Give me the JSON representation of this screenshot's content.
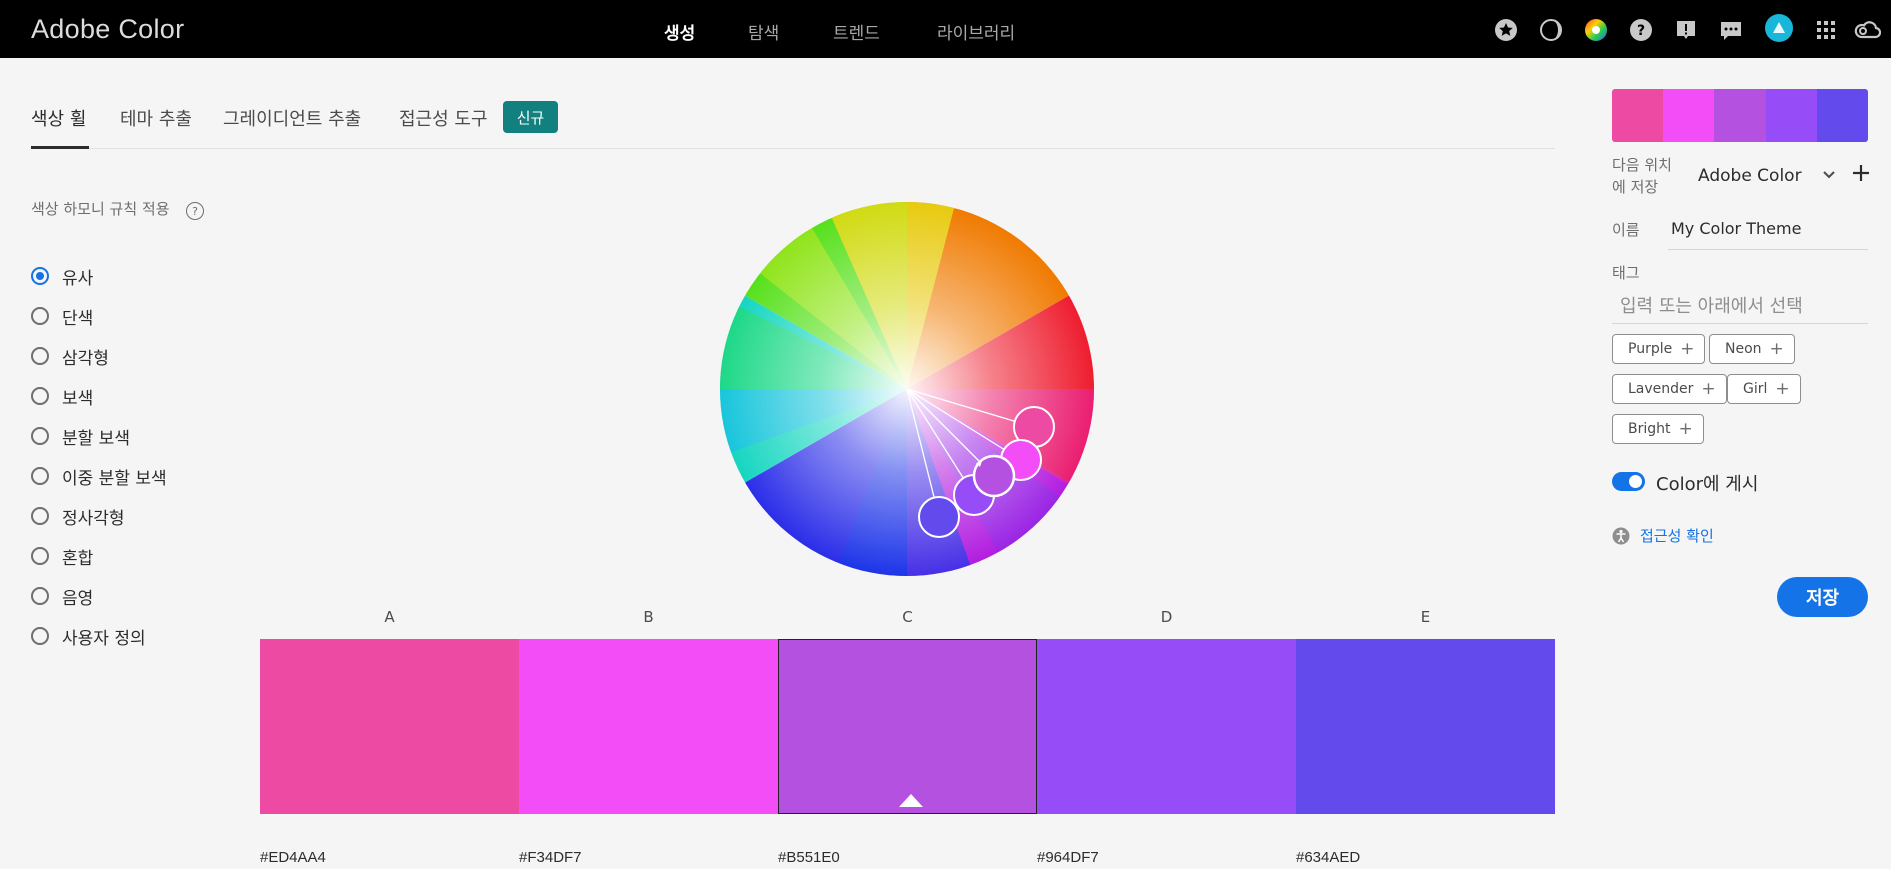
{
  "header": {
    "logo": "Adobe Color",
    "nav": [
      "생성",
      "탐색",
      "트렌드",
      "라이브러리"
    ],
    "active_nav": 0,
    "icons": [
      "star-icon",
      "moon-icon",
      "color-wheel-icon",
      "help-icon",
      "alert-icon",
      "chat-icon",
      "avatar",
      "apps-grid-icon",
      "creative-cloud-icon"
    ]
  },
  "tabs": {
    "items": [
      "색상 휠",
      "테마 추출",
      "그레이디언트 추출",
      "접근성 도구"
    ],
    "active": 0,
    "new_badge": "신규"
  },
  "harmony": {
    "title": "색상 하모니 규칙 적용",
    "selected": 0,
    "options": [
      "유사",
      "단색",
      "삼각형",
      "보색",
      "분할 보색",
      "이중 분할 보색",
      "정사각형",
      "혼합",
      "음영",
      "사용자 정의"
    ]
  },
  "swatches": [
    {
      "letter": "A",
      "hex": "#ED4AA4",
      "color": "#ED4AA4"
    },
    {
      "letter": "B",
      "hex": "#F34DF7",
      "color": "#F34DF7"
    },
    {
      "letter": "C",
      "hex": "#B551E0",
      "color": "#B551E0"
    },
    {
      "letter": "D",
      "hex": "#964DF7",
      "color": "#964DF7"
    },
    {
      "letter": "E",
      "hex": "#634AED",
      "color": "#634AED"
    }
  ],
  "selected_swatch": 2,
  "side_panel": {
    "save_to_label": "다음 위치\n에 저장",
    "save_to_value": "Adobe Color",
    "name_label": "이름",
    "name_value": "My Color Theme",
    "tags_label": "태그",
    "tags_placeholder": "입력 또는 아래에서 선택",
    "tags": [
      "Purple",
      "Neon",
      "Lavender",
      "Girl",
      "Bright"
    ],
    "publish_label": "Color에 게시",
    "publish_on": true,
    "a11y_link": "접근성 확인",
    "save_button": "저장"
  }
}
